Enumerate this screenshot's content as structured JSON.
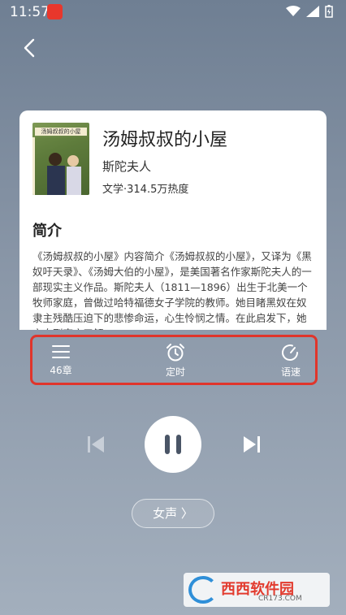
{
  "status_bar": {
    "time": "11:57"
  },
  "book": {
    "title": "汤姆叔叔的小屋",
    "author": "斯陀夫人",
    "meta": "文学·314.5万热度",
    "cover_title": "汤姆叔叔的小屋"
  },
  "intro": {
    "heading": "简介",
    "text": "《汤姆叔叔的小屋》内容简介《汤姆叔叔的小屋》，又译为《黑奴吁天录》、《汤姆大伯的小屋》，是美国著名作家斯陀夫人的一部现实主义作品。斯陀夫人（1811—1896）出生于北美一个牧师家庭，曾做过哈特福德女子学院的教师。她目睹黑奴在奴隶主残酷压迫下的悲惨命运，心生怜悯之情。在此启发下，她亲自到南方了解"
  },
  "controls": {
    "chapters_label": "46章",
    "timer_label": "定时",
    "speed_label": "语速"
  },
  "voice": {
    "label": "女声 〉"
  },
  "watermark": {
    "text": "西西软件园",
    "sub": "CR173.COM"
  },
  "colors": {
    "highlight": "#e0352b",
    "background": "#7d8b9d"
  }
}
